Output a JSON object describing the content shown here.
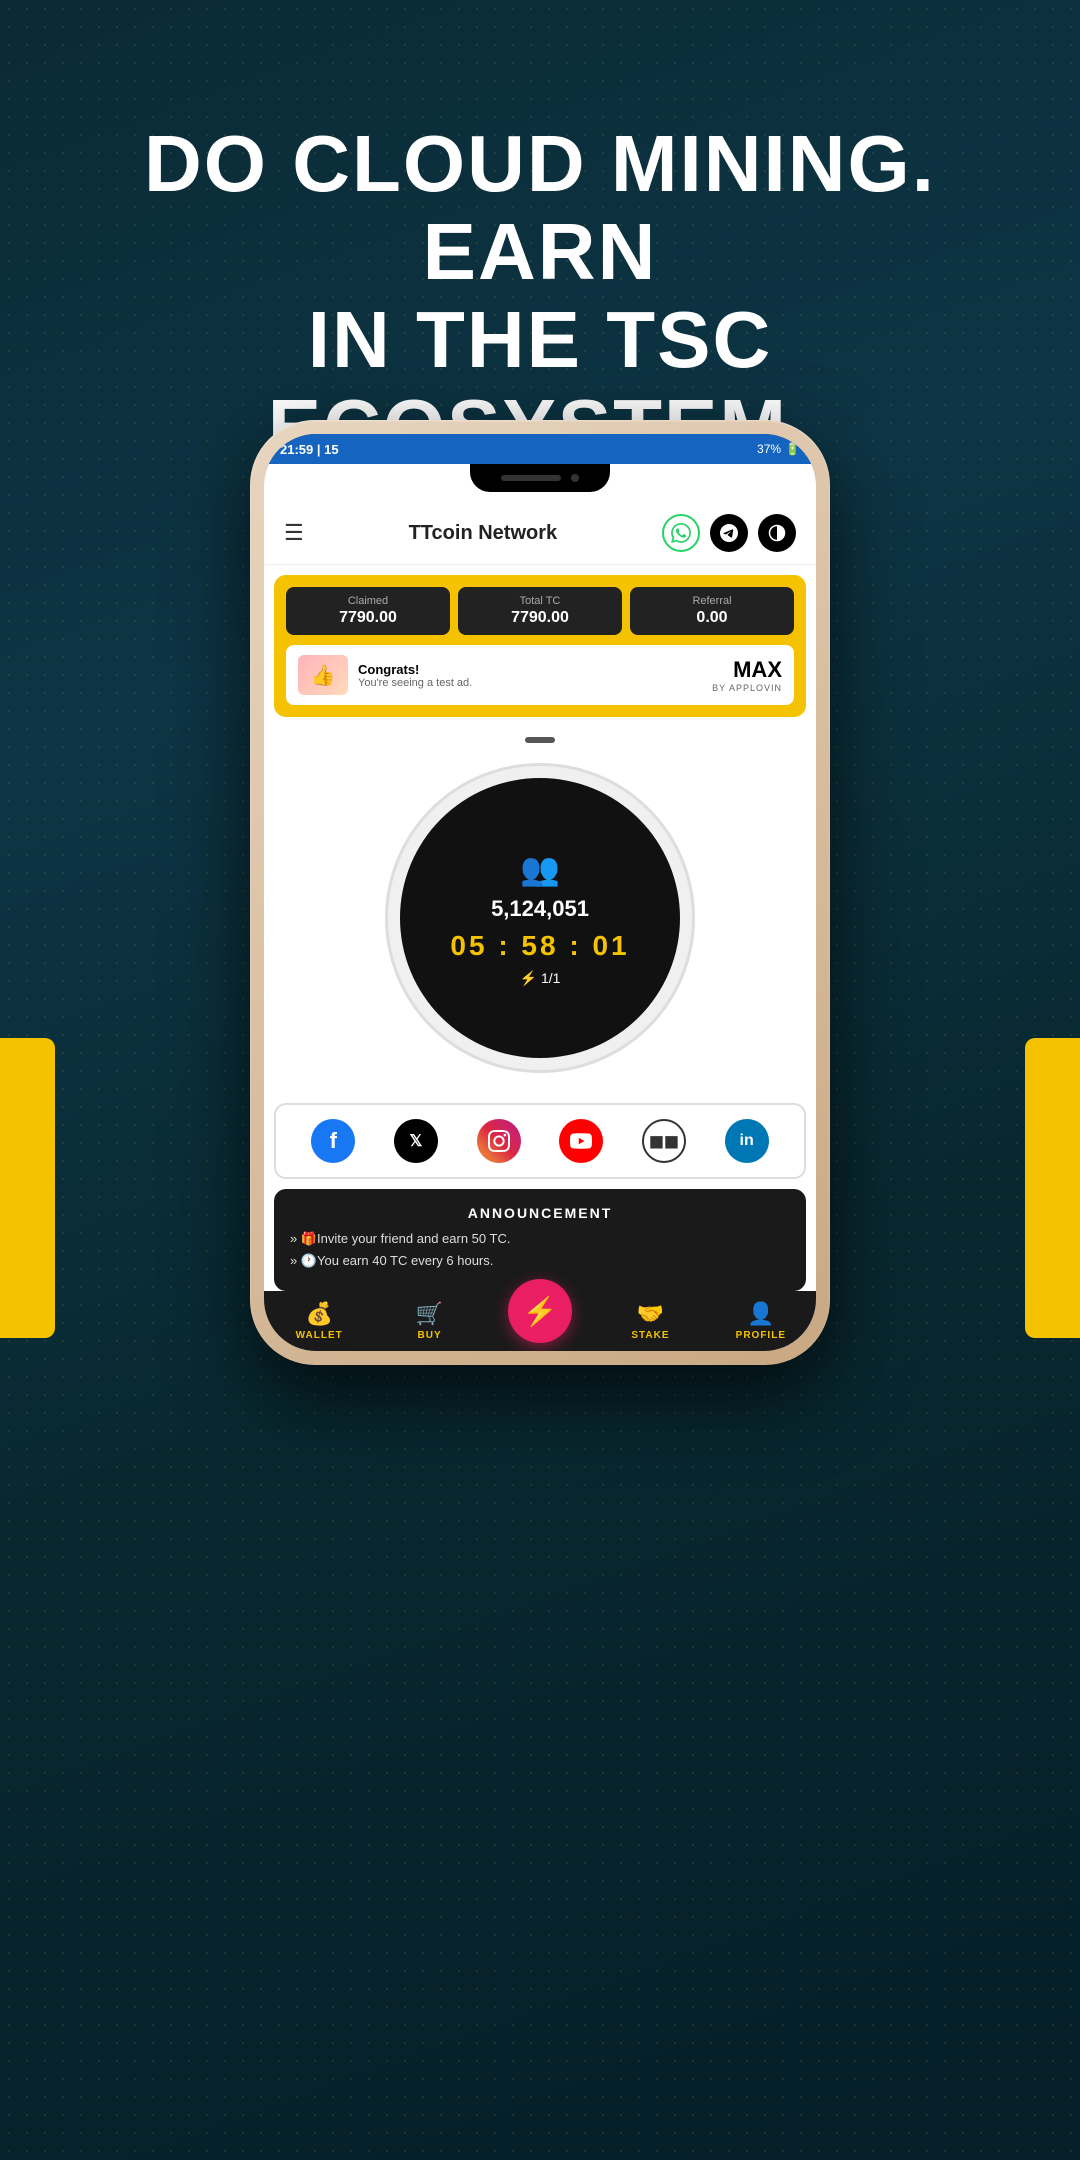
{
  "background": {
    "gradient_start": "#0a2a35",
    "gradient_end": "#061e28"
  },
  "hero": {
    "line1": "DO CLOUD MINING. EARN",
    "line2": "IN THE TSC ECOSYSTEM."
  },
  "status_bar": {
    "time": "21:59 | 15",
    "battery": "37%"
  },
  "nav": {
    "title": "TTcoin Network",
    "menu_icon": "☰",
    "whatsapp_icon": "◎",
    "telegram_icon": "✈",
    "split_icon": "⬤"
  },
  "stats": {
    "claimed_label": "Claimed",
    "claimed_value": "7790.00",
    "total_tc_label": "Total TC",
    "total_tc_value": "7790.00",
    "referral_label": "Referral",
    "referral_value": "0.00"
  },
  "ad": {
    "congrats_text": "Congrats!",
    "sub_text": "You're seeing a test ad.",
    "logo_max": "MAX",
    "logo_by": "BY APPLOVIN"
  },
  "mining": {
    "users_count": "5,124,051",
    "timer": "05 : 58 : 01",
    "boost": "1/1"
  },
  "social": {
    "items": [
      {
        "name": "Facebook",
        "type": "facebook",
        "symbol": "f"
      },
      {
        "name": "Twitter/X",
        "type": "twitter",
        "symbol": "𝕏"
      },
      {
        "name": "Instagram",
        "type": "instagram",
        "symbol": "◎"
      },
      {
        "name": "YouTube",
        "type": "youtube",
        "symbol": "▶"
      },
      {
        "name": "Medium",
        "type": "medium",
        "symbol": "▶▶"
      },
      {
        "name": "LinkedIn",
        "type": "linkedin",
        "symbol": "in"
      }
    ]
  },
  "announcement": {
    "title": "ANNOUNCEMENT",
    "items": [
      "» 🎁Invite your friend and earn 50 TC.",
      "» 🕐You earn 40 TC every 6 hours."
    ]
  },
  "bottom_nav": {
    "items": [
      {
        "id": "wallet",
        "label": "WALLET",
        "icon": "💰"
      },
      {
        "id": "buy",
        "label": "BUY",
        "icon": "🛒"
      },
      {
        "id": "center",
        "label": "",
        "icon": "⚡"
      },
      {
        "id": "stake",
        "label": "STAKE",
        "icon": "🤝"
      },
      {
        "id": "profile",
        "label": "PROFILE",
        "icon": "👤"
      }
    ]
  }
}
